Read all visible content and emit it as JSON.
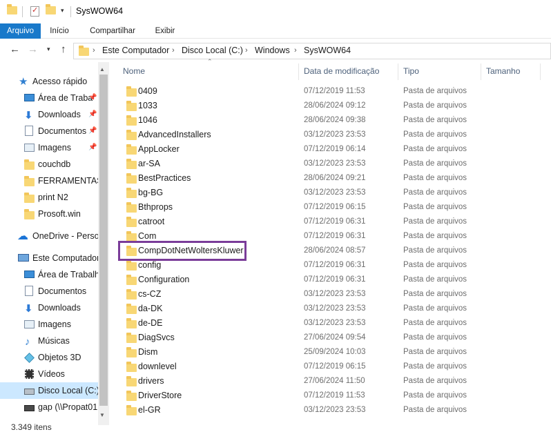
{
  "window": {
    "title": "SysWOW64"
  },
  "ribbon": {
    "tabs": [
      "Arquivo",
      "Início",
      "Compartilhar",
      "Exibir"
    ]
  },
  "address": {
    "crumbs": [
      "Este Computador",
      "Disco Local (C:)",
      "Windows",
      "SysWOW64"
    ]
  },
  "nav": {
    "items": [
      {
        "label": "Acesso rápido",
        "icon": "star-icon",
        "pinned": false
      },
      {
        "label": "Área de Traba",
        "icon": "desktop-icon",
        "pinned": true
      },
      {
        "label": "Downloads",
        "icon": "download-icon",
        "pinned": true
      },
      {
        "label": "Documentos",
        "icon": "documents-icon",
        "pinned": true
      },
      {
        "label": "Imagens",
        "icon": "pictures-icon",
        "pinned": true
      },
      {
        "label": "couchdb",
        "icon": "folder-icon",
        "pinned": false
      },
      {
        "label": "FERRAMENTAS",
        "icon": "folder-icon",
        "pinned": false
      },
      {
        "label": "print N2",
        "icon": "folder-icon",
        "pinned": false
      },
      {
        "label": "Prosoft.win",
        "icon": "folder-icon",
        "pinned": false
      },
      {
        "label": "OneDrive - Persor",
        "icon": "onedrive-icon",
        "pinned": false
      },
      {
        "label": "Este Computador",
        "icon": "computer-icon",
        "pinned": false
      },
      {
        "label": "Área de Trabalho",
        "icon": "desktop-icon",
        "pinned": false
      },
      {
        "label": "Documentos",
        "icon": "documents-icon",
        "pinned": false
      },
      {
        "label": "Downloads",
        "icon": "download-icon",
        "pinned": false
      },
      {
        "label": "Imagens",
        "icon": "pictures-icon",
        "pinned": false
      },
      {
        "label": "Músicas",
        "icon": "music-icon",
        "pinned": false
      },
      {
        "label": "Objetos 3D",
        "icon": "objects-3d-icon",
        "pinned": false
      },
      {
        "label": "Vídeos",
        "icon": "videos-icon",
        "pinned": false
      },
      {
        "label": "Disco Local (C:)",
        "icon": "drive-icon",
        "pinned": false,
        "selected": true
      },
      {
        "label": "gap (\\\\Propat01",
        "icon": "network-drive-icon",
        "pinned": false
      }
    ]
  },
  "columns": {
    "name": "Nome",
    "date": "Data de modificação",
    "type": "Tipo",
    "size": "Tamanho"
  },
  "files": [
    {
      "name": "0409",
      "date": "07/12/2019 11:53",
      "type": "Pasta de arquivos"
    },
    {
      "name": "1033",
      "date": "28/06/2024 09:12",
      "type": "Pasta de arquivos"
    },
    {
      "name": "1046",
      "date": "28/06/2024 09:38",
      "type": "Pasta de arquivos"
    },
    {
      "name": "AdvancedInstallers",
      "date": "03/12/2023 23:53",
      "type": "Pasta de arquivos"
    },
    {
      "name": "AppLocker",
      "date": "07/12/2019 06:14",
      "type": "Pasta de arquivos"
    },
    {
      "name": "ar-SA",
      "date": "03/12/2023 23:53",
      "type": "Pasta de arquivos"
    },
    {
      "name": "BestPractices",
      "date": "28/06/2024 09:21",
      "type": "Pasta de arquivos"
    },
    {
      "name": "bg-BG",
      "date": "03/12/2023 23:53",
      "type": "Pasta de arquivos"
    },
    {
      "name": "Bthprops",
      "date": "07/12/2019 06:15",
      "type": "Pasta de arquivos"
    },
    {
      "name": "catroot",
      "date": "07/12/2019 06:31",
      "type": "Pasta de arquivos"
    },
    {
      "name": "Com",
      "date": "07/12/2019 06:31",
      "type": "Pasta de arquivos"
    },
    {
      "name": "CompDotNetWoltersKluwer",
      "date": "28/06/2024 08:57",
      "type": "Pasta de arquivos"
    },
    {
      "name": "config",
      "date": "07/12/2019 06:31",
      "type": "Pasta de arquivos"
    },
    {
      "name": "Configuration",
      "date": "07/12/2019 06:31",
      "type": "Pasta de arquivos"
    },
    {
      "name": "cs-CZ",
      "date": "03/12/2023 23:53",
      "type": "Pasta de arquivos"
    },
    {
      "name": "da-DK",
      "date": "03/12/2023 23:53",
      "type": "Pasta de arquivos"
    },
    {
      "name": "de-DE",
      "date": "03/12/2023 23:53",
      "type": "Pasta de arquivos"
    },
    {
      "name": "DiagSvcs",
      "date": "27/06/2024 09:54",
      "type": "Pasta de arquivos"
    },
    {
      "name": "Dism",
      "date": "25/09/2024 10:03",
      "type": "Pasta de arquivos"
    },
    {
      "name": "downlevel",
      "date": "07/12/2019 06:15",
      "type": "Pasta de arquivos"
    },
    {
      "name": "drivers",
      "date": "27/06/2024 11:50",
      "type": "Pasta de arquivos"
    },
    {
      "name": "DriverStore",
      "date": "07/12/2019 11:53",
      "type": "Pasta de arquivos"
    },
    {
      "name": "el-GR",
      "date": "03/12/2023 23:53",
      "type": "Pasta de arquivos"
    }
  ],
  "status": {
    "count": "3.349 itens"
  },
  "colors": {
    "accent": "#1979ca",
    "highlight": "#7a3c99",
    "selected": "#cce8ff",
    "folder": "#f8d775"
  }
}
